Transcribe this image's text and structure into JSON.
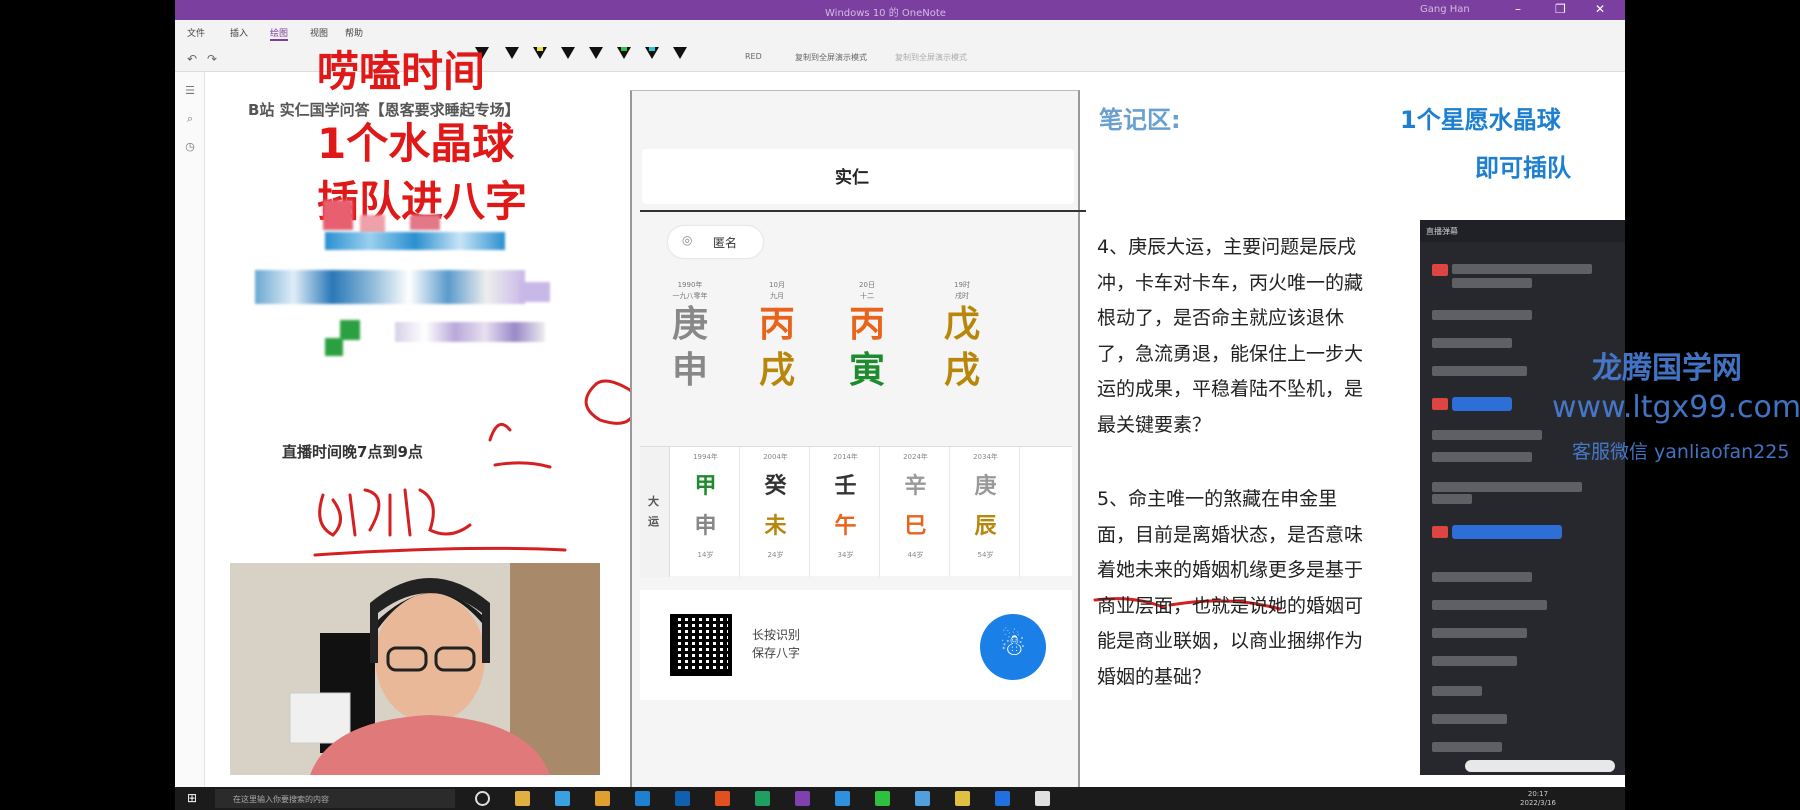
{
  "window": {
    "title": "Windows 10 的 OneNote",
    "user": "Gang Han"
  },
  "menu": [
    "文件",
    "插入",
    "绘图",
    "视图",
    "帮助"
  ],
  "toolbar": {
    "btn1": "RED",
    "btn2": "复制到全屏演示模式",
    "btn3": "复制到全屏演示模式"
  },
  "overlay": {
    "line1": "唠嗑时间",
    "line2": "1个水晶球",
    "line3": "插队进八字",
    "bilibili": "B站 实仁国学问答【恩客要求睡起专场】",
    "schedule": "直播时间晚7点到9点"
  },
  "phone": {
    "title": "实仁",
    "anon": "匿名",
    "pillars": [
      {
        "d1": "1990年",
        "d2": "一九八零年",
        "gan": "庚",
        "zhi": "申",
        "gan_color": "#888888",
        "zhi_color": "#888888"
      },
      {
        "d1": "10月",
        "d2": "九月",
        "gan": "丙",
        "zhi": "戌",
        "gan_color": "#e8641a",
        "zhi_color": "#b8860b"
      },
      {
        "d1": "20日",
        "d2": "十二",
        "gan": "丙",
        "zhi": "寅",
        "gan_color": "#e8641a",
        "zhi_color": "#1e8c2e"
      },
      {
        "d1": "19时",
        "d2": "戌时",
        "gan": "戊",
        "zhi": "戌",
        "gan_color": "#b8860b",
        "zhi_color": "#b8860b"
      }
    ],
    "dayun_label": "大运",
    "dayun": [
      {
        "year": "1994年",
        "gan": "甲",
        "zhi": "申",
        "age": "14岁",
        "gc": "#1e8c2e",
        "zc": "#888888"
      },
      {
        "year": "2004年",
        "gan": "癸",
        "zhi": "未",
        "age": "24岁",
        "gc": "#333333",
        "zc": "#b8860b"
      },
      {
        "year": "2014年",
        "gan": "壬",
        "zhi": "午",
        "age": "34岁",
        "gc": "#333333",
        "zc": "#e8641a"
      },
      {
        "year": "2024年",
        "gan": "辛",
        "zhi": "巳",
        "age": "44岁",
        "gc": "#999999",
        "zc": "#e8641a"
      },
      {
        "year": "2034年",
        "gan": "庚",
        "zhi": "辰",
        "age": "54岁",
        "gc": "#999999",
        "zc": "#b8860b"
      }
    ],
    "qr_text1": "长按识别",
    "qr_text2": "保存八字",
    "u_icon": "person-icon"
  },
  "notes": {
    "label": "笔记区:",
    "crystal1": "1个星愿水晶球",
    "crystal2": "即可插队",
    "q4": "4、庚辰大运，主要问题是辰戌冲，卡车对卡车，丙火唯一的藏根动了，是否命主就应该退休了，急流勇退，能保住上一步大运的成果，平稳着陆不坠机，是最关键要素？",
    "q5": "5、命主唯一的煞藏在申金里面，目前是离婚状态，是否意味着她未来的婚姻机缘更多是基于商业层面，也就是说她的婚姻可能是商业联姻，以商业捆绑作为婚姻的基础？"
  },
  "chat": {
    "title": "直播弹幕"
  },
  "watermark": {
    "line1": "龙腾国学网",
    "line2": "www.ltgx99.com",
    "line3": "客服微信 yanliaofan225"
  },
  "taskbar": {
    "search": "在这里输入你要搜索的内容",
    "time": "20:17",
    "date": "2022/3/16"
  }
}
